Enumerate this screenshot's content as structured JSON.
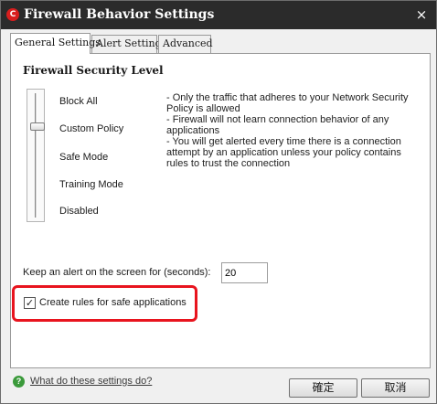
{
  "window": {
    "title": "Firewall Behavior Settings",
    "close_glyph": "×",
    "app_icon_glyph": "C"
  },
  "tabs": [
    {
      "label": "General Settings",
      "selected": true
    },
    {
      "label": "Alert Settings",
      "selected": false
    },
    {
      "label": "Advanced",
      "selected": false
    }
  ],
  "general": {
    "section_title": "Firewall Security Level",
    "levels": [
      "Block All",
      "Custom Policy",
      "Safe Mode",
      "Training Mode",
      "Disabled"
    ],
    "selected_level": "Custom Policy",
    "description": [
      "- Only the traffic that adheres to your Network Security Policy is allowed",
      "- Firewall will not learn connection behavior of any applications",
      "- You will get alerted every time there is a connection attempt by an application unless your policy contains rules to trust the connection"
    ],
    "alert_timeout_label": "Keep an alert on the screen for (seconds):",
    "alert_timeout_value": "20",
    "create_rules_label": "Create rules for safe applications",
    "create_rules_checked": true,
    "checkbox_glyph": "✓"
  },
  "footer": {
    "help_glyph": "?",
    "help_link": "What do these settings do?",
    "ok_label": "確定",
    "cancel_label": "取消"
  },
  "colors": {
    "titlebar": "#2b2b2b",
    "app_icon": "#d81e1e",
    "highlight": "#e8141e",
    "help_icon": "#3b9a3b"
  }
}
